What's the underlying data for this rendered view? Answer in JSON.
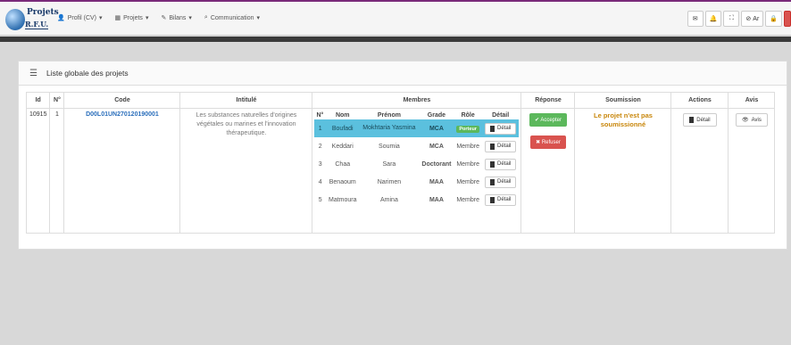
{
  "logo": {
    "line1": "Projets",
    "line2": "R.F.U."
  },
  "nav": [
    {
      "icon": "user-icon",
      "glyph": "👤",
      "label": "Profil (CV)",
      "caret": "▾"
    },
    {
      "icon": "grid-icon",
      "glyph": "▦",
      "label": "Projets",
      "caret": "▾"
    },
    {
      "icon": "pencil-icon",
      "glyph": "✎",
      "label": "Bilans",
      "caret": "▾"
    },
    {
      "icon": "chat-icon",
      "glyph": "⌕",
      "label": "Communication",
      "caret": "▾"
    }
  ],
  "topright": {
    "lang_label": "Ar"
  },
  "panel": {
    "title": "Liste globale des projets"
  },
  "table": {
    "headers": [
      "Id",
      "N°",
      "Code",
      "Intitulé",
      "Membres",
      "Réponse",
      "Soumission",
      "Actions",
      "Avis"
    ],
    "row": {
      "id": "10915",
      "num": "1",
      "code": "D00L01UN270120190001",
      "intitule": "Les substances naturelles d'origines végétales ou marines et l'innovation thérapeutique.",
      "soumission": "Le projet n'est pas soumissionné"
    },
    "members_headers": [
      "N°",
      "Nom",
      "Prénom",
      "Grade",
      "Rôle",
      "Détail"
    ],
    "members": [
      {
        "n": "1",
        "nom": "Boufadi",
        "prenom": "Mokhtaria Yasmina",
        "grade": "MCA",
        "role": "Porteur",
        "detail": "Détail"
      },
      {
        "n": "2",
        "nom": "Keddari",
        "prenom": "Soumia",
        "grade": "MCA",
        "role": "Membre",
        "detail": "Détail"
      },
      {
        "n": "3",
        "nom": "Chaa",
        "prenom": "Sara",
        "grade": "Doctorant",
        "role": "Membre",
        "detail": "Détail"
      },
      {
        "n": "4",
        "nom": "Benaoum",
        "prenom": "Narimen",
        "grade": "MAA",
        "role": "Membre",
        "detail": "Détail"
      },
      {
        "n": "5",
        "nom": "Matmoura",
        "prenom": "Amina",
        "grade": "MAA",
        "role": "Membre",
        "detail": "Détail"
      }
    ],
    "reponse": {
      "accept": "Accepter",
      "refuse": "Refuser"
    },
    "actions": {
      "detail": "Détail"
    },
    "avis": {
      "label": "Avis"
    }
  },
  "colors": {
    "accent": "#2a6ebb",
    "success": "#5cb85c",
    "danger": "#d9534f",
    "info": "#5bc0de",
    "warning": "#c8860a"
  }
}
